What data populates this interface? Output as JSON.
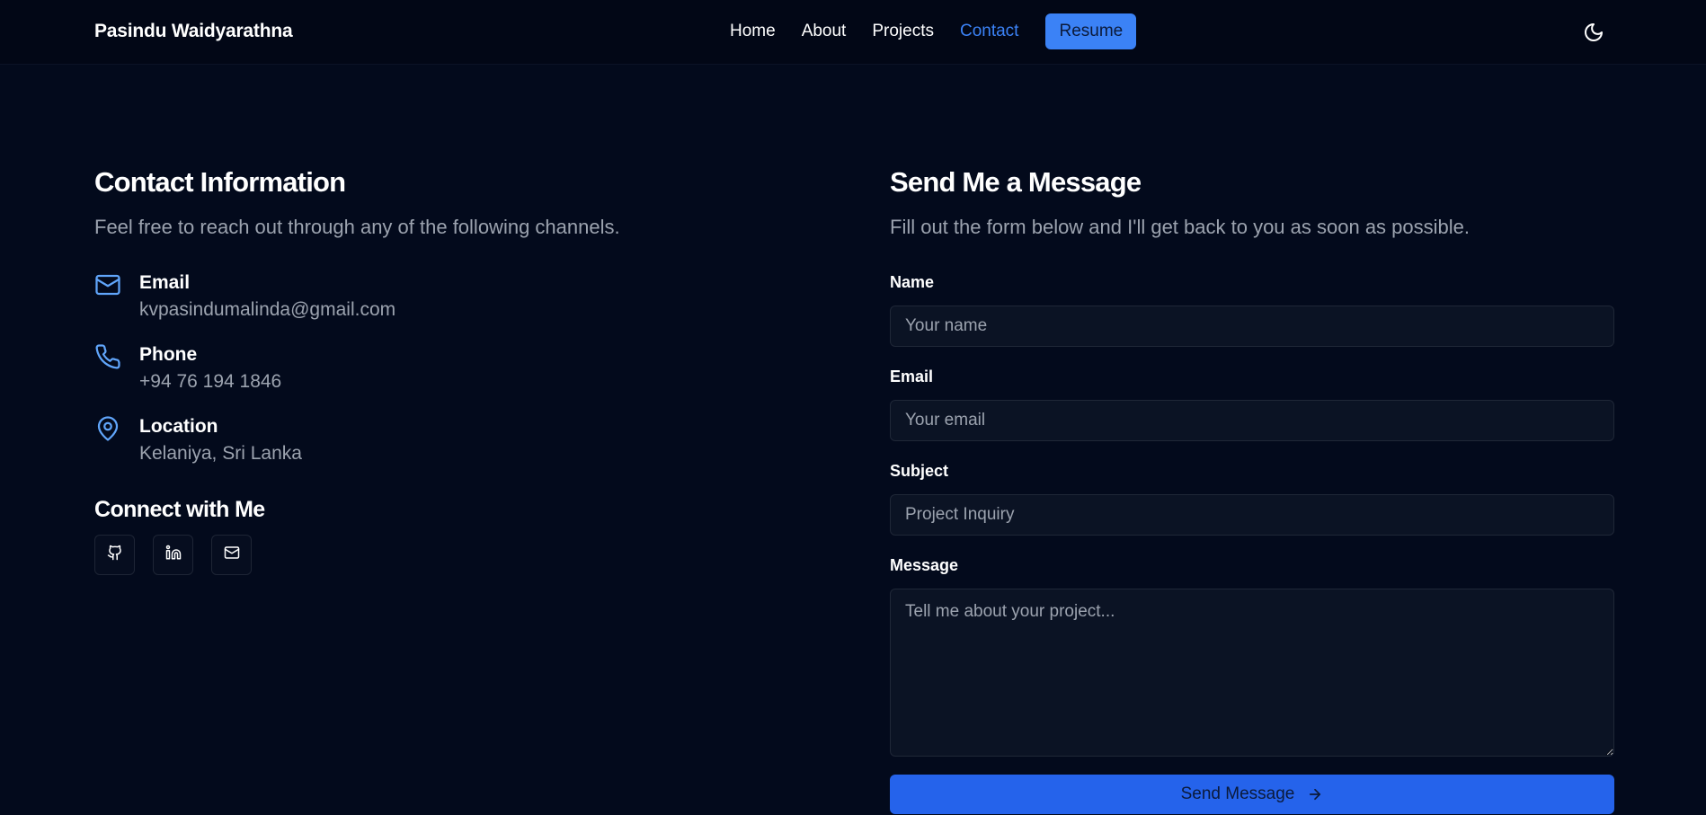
{
  "header": {
    "brand": "Pasindu Waidyarathna",
    "nav": [
      {
        "label": "Home",
        "active": false
      },
      {
        "label": "About",
        "active": false
      },
      {
        "label": "Projects",
        "active": false
      },
      {
        "label": "Contact",
        "active": true
      }
    ],
    "resume_label": "Resume",
    "theme_icon": "moon-icon"
  },
  "contact_info": {
    "title": "Contact Information",
    "subtitle": "Feel free to reach out through any of the following channels.",
    "items": [
      {
        "icon": "mail-icon",
        "label": "Email",
        "value": "kvpasindumalinda@gmail.com"
      },
      {
        "icon": "phone-icon",
        "label": "Phone",
        "value": "+94 76 194 1846"
      },
      {
        "icon": "map-pin-icon",
        "label": "Location",
        "value": "Kelaniya, Sri Lanka"
      }
    ],
    "connect_title": "Connect with Me",
    "socials": [
      "github-icon",
      "linkedin-icon",
      "mail-icon"
    ]
  },
  "form": {
    "title": "Send Me a Message",
    "subtitle": "Fill out the form below and I'll get back to you as soon as possible.",
    "name_label": "Name",
    "name_placeholder": "Your name",
    "email_label": "Email",
    "email_placeholder": "Your email",
    "subject_label": "Subject",
    "subject_placeholder": "Project Inquiry",
    "message_label": "Message",
    "message_placeholder": "Tell me about your project...",
    "submit_label": "Send Message"
  },
  "colors": {
    "background": "#030a1c",
    "accent": "#3b82f6",
    "button": "#2563eb",
    "muted_text": "#9ca3af"
  }
}
